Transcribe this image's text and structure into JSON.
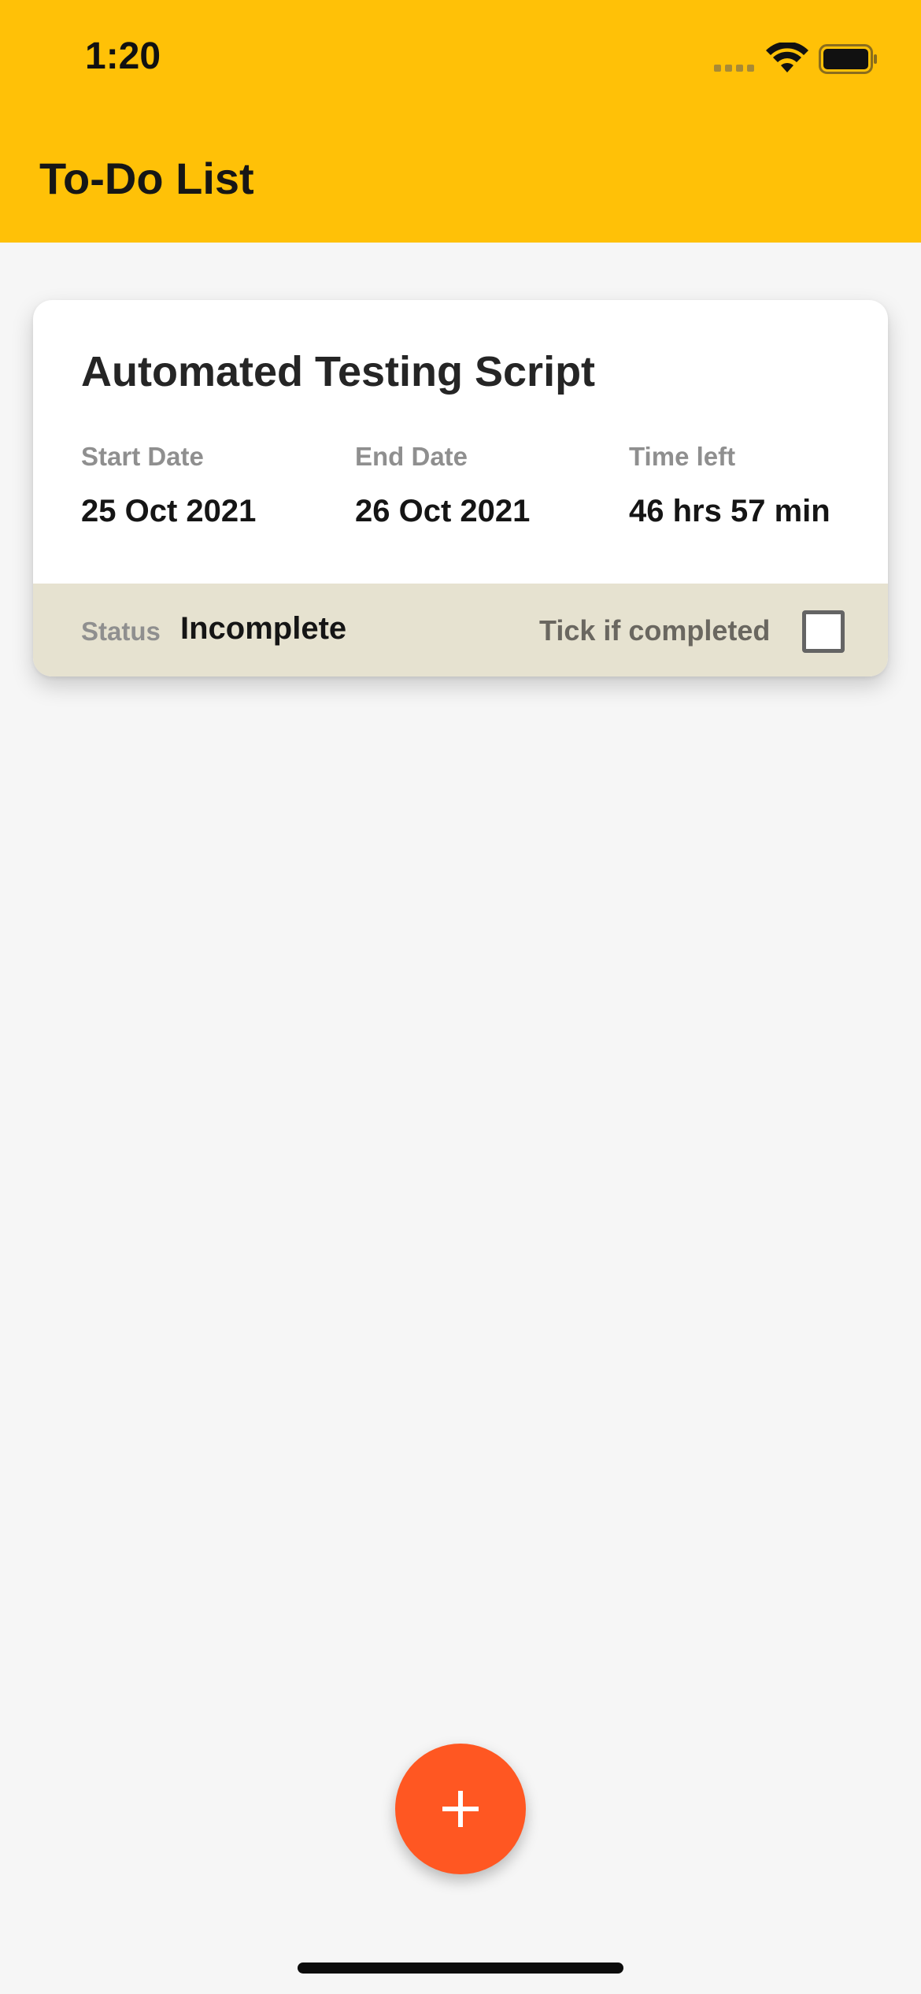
{
  "status_bar": {
    "time": "1:20",
    "icons": [
      "cellular-signal-icon",
      "wifi-icon",
      "battery-icon"
    ]
  },
  "app_bar": {
    "title": "To-Do List",
    "color": "#ffc107"
  },
  "tasks": [
    {
      "title": "Automated Testing Script",
      "start_date_label": "Start Date",
      "start_date": "25 Oct 2021",
      "end_date_label": "End Date",
      "end_date": "26 Oct 2021",
      "time_left_label": "Time left",
      "time_left": "46 hrs 57 min",
      "status_label": "Status",
      "status": "Incomplete",
      "tick_label": "Tick if completed",
      "completed": false
    }
  ],
  "fab": {
    "icon": "plus-icon",
    "color": "#ff5722"
  }
}
